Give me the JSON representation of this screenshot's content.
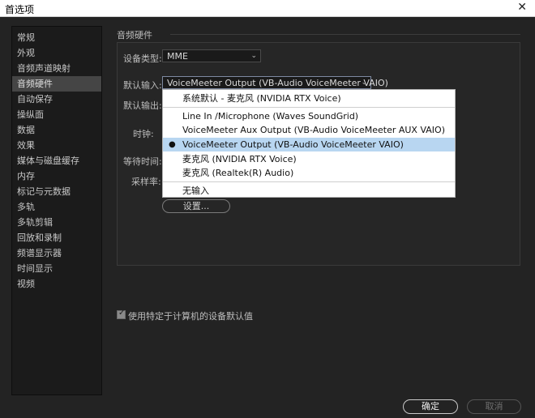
{
  "window": {
    "title": "首选项",
    "close_glyph": "✕"
  },
  "sidebar": {
    "items": [
      {
        "label": "常规"
      },
      {
        "label": "外观"
      },
      {
        "label": "音频声道映射"
      },
      {
        "label": "音频硬件"
      },
      {
        "label": "自动保存"
      },
      {
        "label": "操纵面"
      },
      {
        "label": "数据"
      },
      {
        "label": "效果"
      },
      {
        "label": "媒体与磁盘缓存"
      },
      {
        "label": "内存"
      },
      {
        "label": "标记与元数据"
      },
      {
        "label": "多轨"
      },
      {
        "label": "多轨剪辑"
      },
      {
        "label": "回放和录制"
      },
      {
        "label": "频谱显示器"
      },
      {
        "label": "时间显示"
      },
      {
        "label": "视频"
      }
    ],
    "active_index": 3
  },
  "section": {
    "title": "音频硬件"
  },
  "fields": {
    "device_type": {
      "label": "设备类型:",
      "value": "MME"
    },
    "default_input": {
      "label": "默认输入:",
      "value": "VoiceMeeter Output (VB-Audio VoiceMeeter VAIO)"
    },
    "default_output": {
      "label": "默认输出:"
    },
    "clock": {
      "label": "时钟:"
    },
    "latency": {
      "label": "等待时间:"
    },
    "sample_rate": {
      "label": "采样率:"
    },
    "settings_button": "设置..."
  },
  "dropdown": {
    "items": [
      {
        "label": "系统默认 - 麦克风 (NVIDIA RTX Voice)"
      },
      {
        "label": "Line In /Microphone (Waves SoundGrid)"
      },
      {
        "label": "VoiceMeeter Aux Output (VB-Audio VoiceMeeter AUX VAIO)"
      },
      {
        "label": "VoiceMeeter Output (VB-Audio VoiceMeeter VAIO)"
      },
      {
        "label": "麦克风 (NVIDIA RTX Voice)"
      },
      {
        "label": "麦克风 (Realtek(R) Audio)"
      },
      {
        "label": "无输入"
      }
    ],
    "selected_index": 3,
    "bullet": "●"
  },
  "checkbox": {
    "label": "使用特定于计算机的设备默认值",
    "checked": true,
    "tick": "✓"
  },
  "buttons": {
    "ok": "确定",
    "cancel": "取消"
  },
  "icons": {
    "chevron": "chevron-down-icon",
    "close": "close-icon"
  }
}
